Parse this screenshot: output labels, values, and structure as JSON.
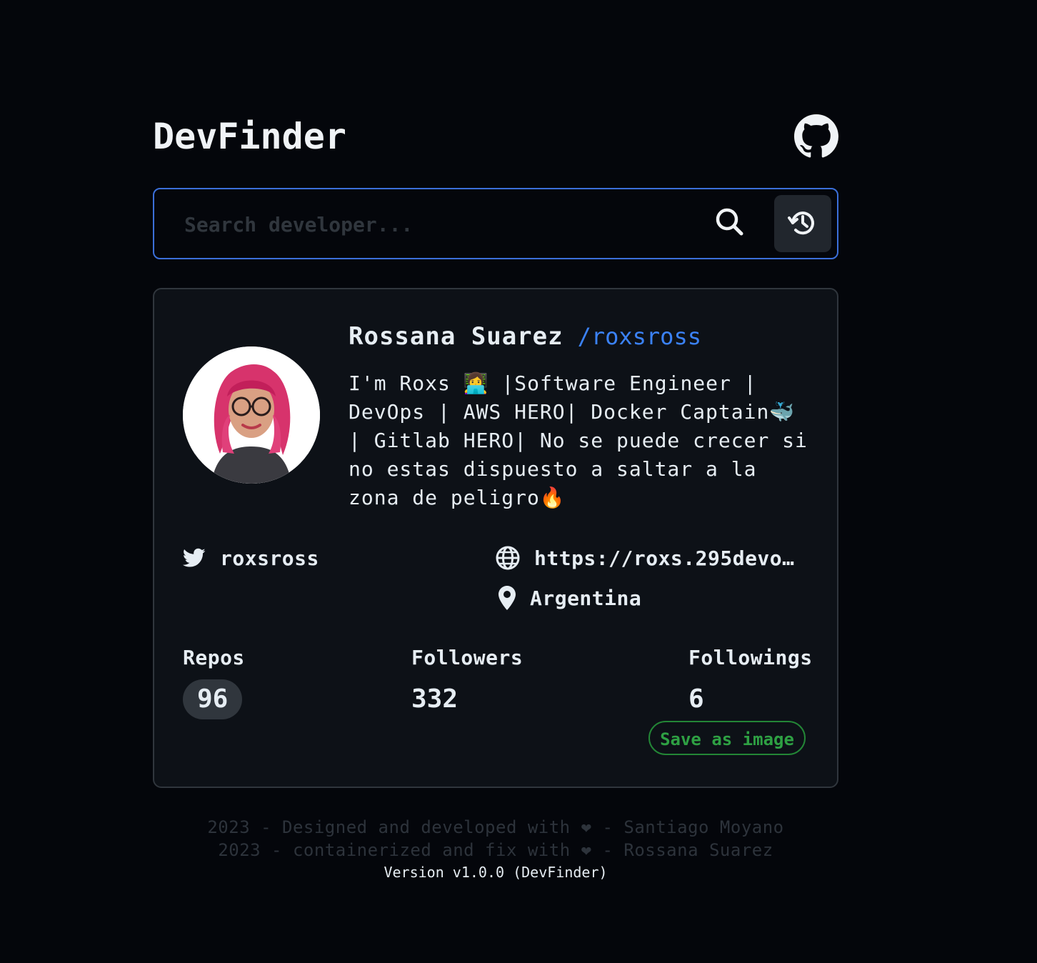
{
  "header": {
    "title": "DevFinder",
    "github_icon": "github-icon"
  },
  "search": {
    "placeholder": "Search developer...",
    "value": "",
    "search_icon": "search-icon",
    "history_icon": "history-icon"
  },
  "profile": {
    "name": "Rossana Suarez",
    "login": "/roxsross",
    "bio": "I'm Roxs 👩‍💻 |Software Engineer | DevOps | AWS HERO| Docker Captain🐳 | Gitlab HERO| No se puede crecer si no estas dispuesto a saltar a la zona de peligro🔥",
    "twitter": "roxsross",
    "blog": "https://roxs.295devops.com",
    "location": "Argentina",
    "stats": {
      "repos_label": "Repos",
      "repos": "96",
      "followers_label": "Followers",
      "followers": "332",
      "following_label": "Followings",
      "following": "6"
    },
    "save_label": "Save as image"
  },
  "footer": {
    "line1": "2023 - Designed and developed with ❤ - Santiago Moyano",
    "line2": "2023 - containerized and fix with ❤ - Rossana Suarez",
    "version": "Version v1.0.0 (DevFinder)"
  },
  "colors": {
    "background": "#04060b",
    "card": "#0d1117",
    "accent_blue": "#3b82f6",
    "search_border": "#3b6fd9",
    "save_green": "#2ea043"
  }
}
